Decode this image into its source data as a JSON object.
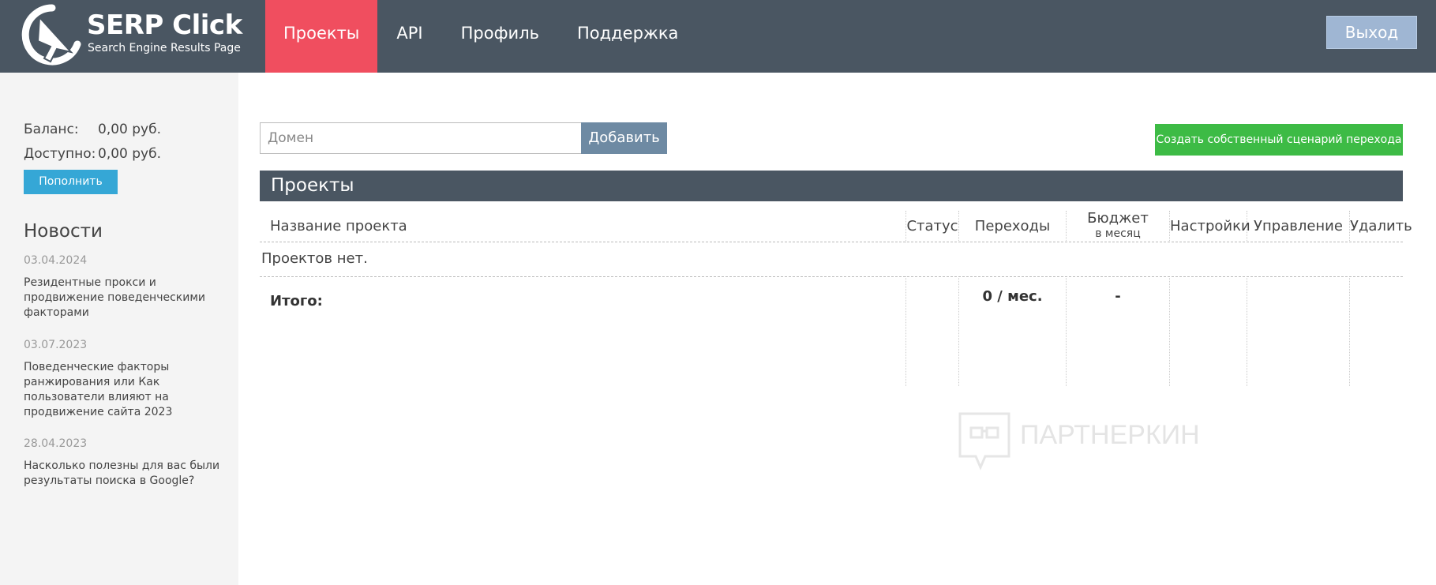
{
  "header": {
    "logo": {
      "title": "SERP Click",
      "subtitle": "Search Engine Results Page"
    },
    "nav": [
      {
        "label": "Проекты",
        "active": true
      },
      {
        "label": "API",
        "active": false
      },
      {
        "label": "Профиль",
        "active": false
      },
      {
        "label": "Поддержка",
        "active": false
      }
    ],
    "logout_label": "Выход"
  },
  "sidebar": {
    "balance_label": "Баланс:",
    "balance_value": "0,00 руб.",
    "available_label": "Доступно:",
    "available_value": "0,00 руб.",
    "topup_label": "Пополнить",
    "news_title": "Новости",
    "news": [
      {
        "date": "03.04.2024",
        "text": "Резидентные прокси и продвижение поведенческими факторами"
      },
      {
        "date": "03.07.2023",
        "text": "Поведенческие факторы ранжирования или Как пользователи влияют на продвижение сайта 2023"
      },
      {
        "date": "28.04.2023",
        "text": "Насколько полезны для вас были результаты поиска в Google?"
      }
    ]
  },
  "main": {
    "domain_placeholder": "Домен",
    "add_label": "Добавить",
    "create_label": "Создать собственный сценарий перехода",
    "projects_title": "Проекты",
    "columns": {
      "name": "Название проекта",
      "status": "Статус",
      "clicks": "Переходы",
      "budget": "Бюджет",
      "budget_sub": "в месяц",
      "settings": "Настройки",
      "manage": "Управление",
      "delete": "Удалить"
    },
    "empty_text": "Проектов нет.",
    "total_label": "Итого:",
    "total_clicks": "0 / мес.",
    "total_budget": "-"
  },
  "watermark": {
    "text": "ПАРТНЕРКИН"
  },
  "colors": {
    "header_bg": "#4a5662",
    "nav_active": "#f04e5f",
    "logout_bg": "#9fb6d3",
    "topup_bg": "#35a7d6",
    "add_bg": "#6e8aa3",
    "create_bg": "#3dbb45"
  }
}
